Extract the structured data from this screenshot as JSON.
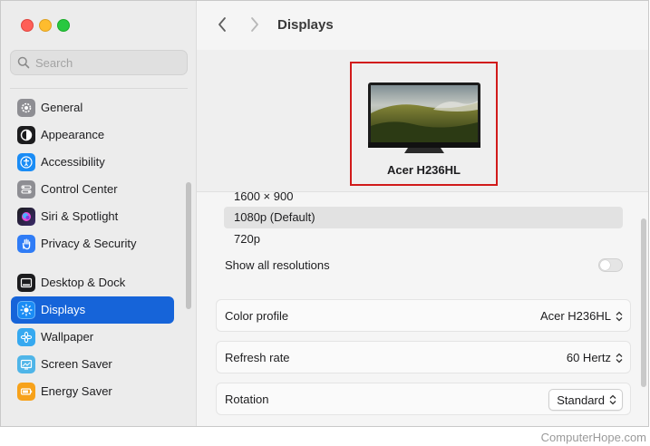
{
  "window": {
    "title": "Displays"
  },
  "search": {
    "placeholder": "Search"
  },
  "sidebar": {
    "items": [
      {
        "label": "General",
        "icon": "gear-icon",
        "color": "#8e8e93"
      },
      {
        "label": "Appearance",
        "icon": "appearance-icon",
        "color": "#1c1c1e"
      },
      {
        "label": "Accessibility",
        "icon": "accessibility-icon",
        "color": "#1a8cf5"
      },
      {
        "label": "Control Center",
        "icon": "control-center-icon",
        "color": "#8e8e93"
      },
      {
        "label": "Siri & Spotlight",
        "icon": "siri-icon",
        "color": "#7b3fe4"
      },
      {
        "label": "Privacy & Security",
        "icon": "hand-icon",
        "color": "#2f7cf6"
      },
      {
        "label": "Desktop & Dock",
        "icon": "dock-icon",
        "color": "#1c1c1e"
      },
      {
        "label": "Displays",
        "icon": "sun-icon",
        "color": "#1a8cf5",
        "active": true
      },
      {
        "label": "Wallpaper",
        "icon": "flower-icon",
        "color": "#36a9f0"
      },
      {
        "label": "Screen Saver",
        "icon": "screen-saver-icon",
        "color": "#4fb5e8"
      },
      {
        "label": "Energy Saver",
        "icon": "battery-icon",
        "color": "#f7a21b"
      }
    ]
  },
  "display": {
    "name": "Acer H236HL"
  },
  "resolutions": {
    "items": [
      "1600 × 900",
      "1080p (Default)",
      "720p"
    ],
    "selected": "1080p (Default)",
    "show_all_label": "Show all resolutions",
    "show_all_on": false
  },
  "settings": {
    "color_profile": {
      "label": "Color profile",
      "value": "Acer H236HL"
    },
    "refresh_rate": {
      "label": "Refresh rate",
      "value": "60 Hertz"
    },
    "rotation": {
      "label": "Rotation",
      "value": "Standard"
    }
  },
  "colors": {
    "accent": "#1664d9",
    "highlight_box": "#d11a1a"
  },
  "watermark": "ComputerHope.com"
}
